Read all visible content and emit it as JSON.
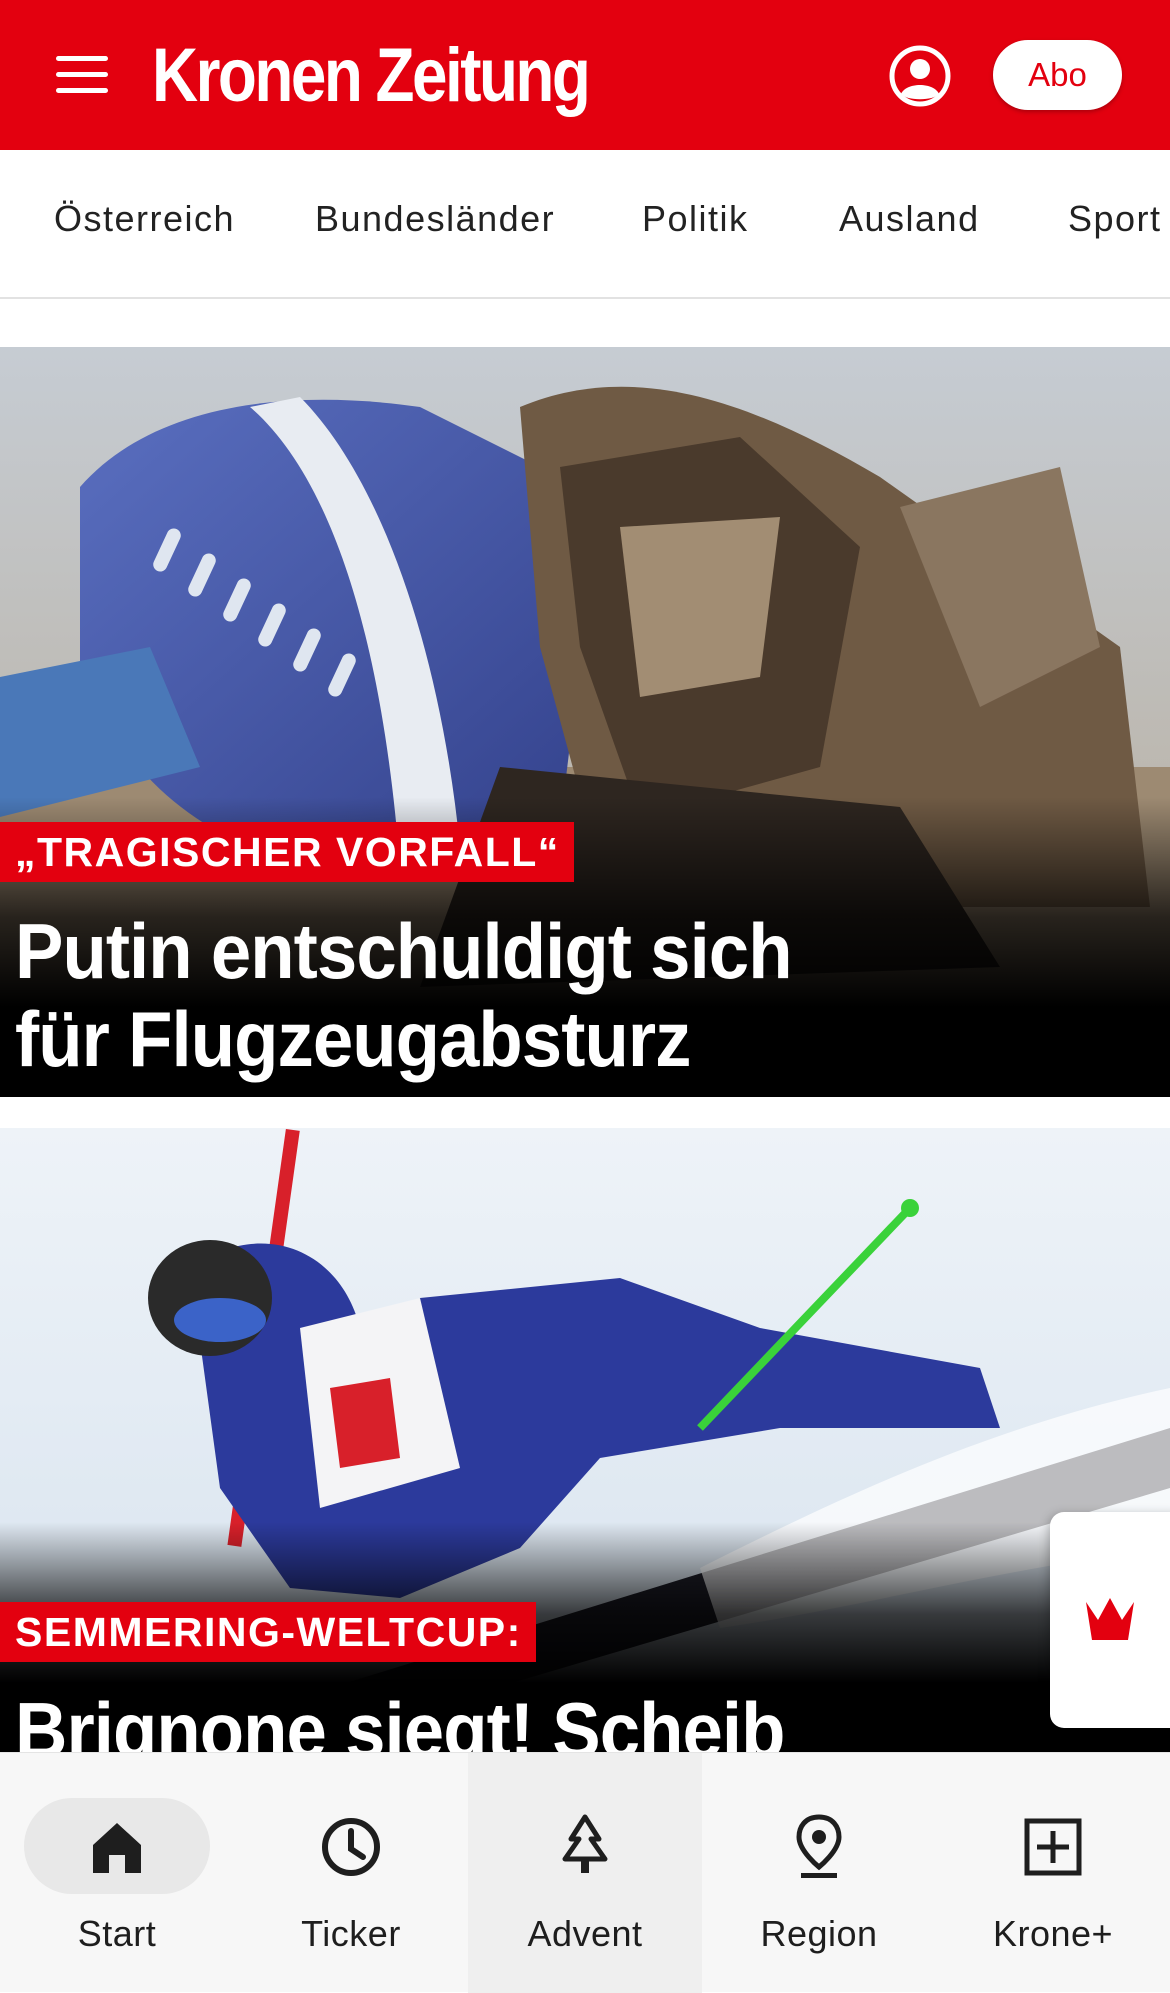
{
  "header": {
    "brand": "Kronen Zeitung",
    "abo_label": "Abo",
    "accent_color": "#e3000f"
  },
  "nav": {
    "items": [
      "Österreich",
      "Bundesländer",
      "Politik",
      "Ausland",
      "Sport"
    ]
  },
  "articles": [
    {
      "kicker": "„TRAGISCHER VORFALL“",
      "headline_line1": "Putin entschuldigt sich",
      "headline_line2": "für Flugzeugabsturz",
      "image": "plane-crash-wreckage"
    },
    {
      "kicker": "SEMMERING-WELTCUP:",
      "headline_line1": "Brignone siegt! Scheib",
      "image": "ski-racer-giant-slalom"
    }
  ],
  "side_tab": {
    "icon": "crown-icon"
  },
  "bottom_nav": {
    "items": [
      {
        "label": "Start",
        "icon": "home-icon",
        "active": true
      },
      {
        "label": "Ticker",
        "icon": "clock-icon"
      },
      {
        "label": "Advent",
        "icon": "tree-icon"
      },
      {
        "label": "Region",
        "icon": "location-pin-icon"
      },
      {
        "label": "Krone+",
        "icon": "plus-box-icon"
      }
    ]
  }
}
